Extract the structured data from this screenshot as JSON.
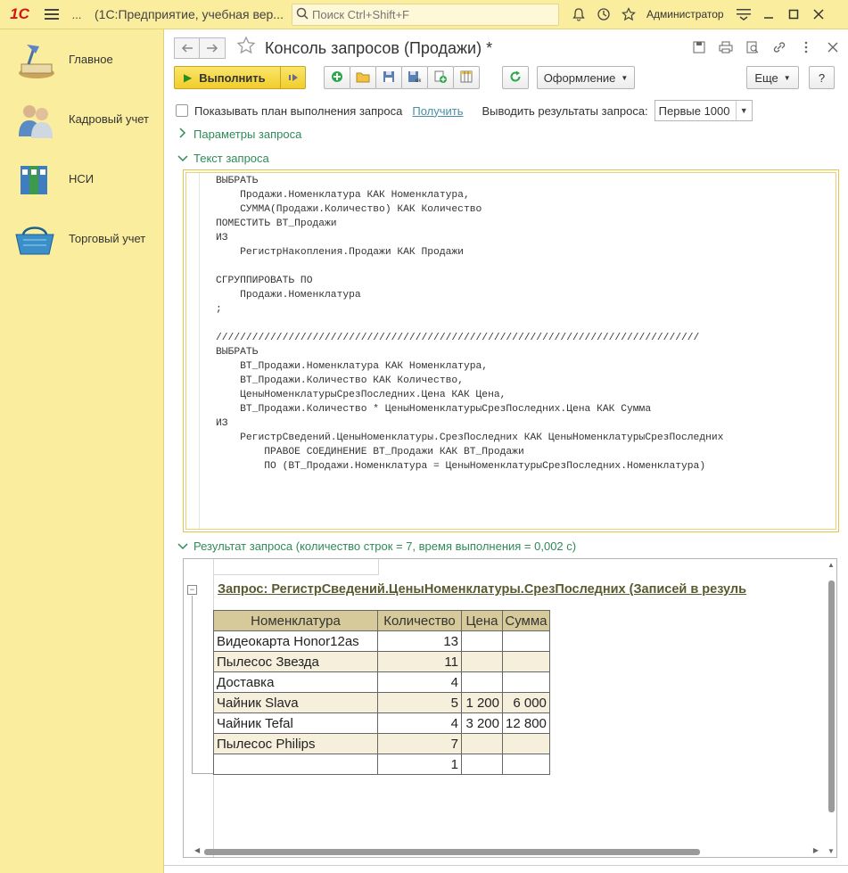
{
  "topbar": {
    "logo": "1С",
    "ellipsis": "...",
    "app_title": "(1С:Предприятие, учебная вер...",
    "search_placeholder": "Поиск Ctrl+Shift+F",
    "user": "Администратор"
  },
  "sidebar": {
    "items": [
      {
        "label": "Главное",
        "icon": "desk-lamp-icon"
      },
      {
        "label": "Кадровый учет",
        "icon": "people-icon"
      },
      {
        "label": "НСИ",
        "icon": "binders-icon"
      },
      {
        "label": "Торговый учет",
        "icon": "basket-icon"
      }
    ]
  },
  "form": {
    "title": "Консоль запросов (Продажи) *"
  },
  "cmdbar": {
    "execute_label": "Выполнить",
    "design_label": "Оформление",
    "more_label": "Еще",
    "help_label": "?"
  },
  "options": {
    "show_plan_label": "Показывать план выполнения запроса",
    "get_link": "Получить",
    "output_label": "Выводить результаты запроса:",
    "output_value": "Первые 1000"
  },
  "groups": {
    "params": "Параметры запроса",
    "text": "Текст запроса",
    "result": "Результат запроса (количество строк = 7, время выполнения = 0,002 с)"
  },
  "query_text": "ВЫБРАТЬ\n    Продажи.Номенклатура КАК Номенклатура,\n    СУММА(Продажи.Количество) КАК Количество\nПОМЕСТИТЬ ВТ_Продажи\nИЗ\n    РегистрНакопления.Продажи КАК Продажи\n\nСГРУППИРОВАТЬ ПО\n    Продажи.Номенклатура\n;\n\n////////////////////////////////////////////////////////////////////////////////\nВЫБРАТЬ\n    ВТ_Продажи.Номенклатура КАК Номенклатура,\n    ВТ_Продажи.Количество КАК Количество,\n    ЦеныНоменклатурыСрезПоследних.Цена КАК Цена,\n    ВТ_Продажи.Количество * ЦеныНоменклатурыСрезПоследних.Цена КАК Сумма\nИЗ\n    РегистрСведений.ЦеныНоменклатуры.СрезПоследних КАК ЦеныНоменклатурыСрезПоследних\n        ПРАВОЕ СОЕДИНЕНИЕ ВТ_Продажи КАК ВТ_Продажи\n        ПО (ВТ_Продажи.Номенклатура = ЦеныНоменклатурыСрезПоследних.Номенклатура)",
  "result": {
    "heading": "Запрос: РегистрСведений.ЦеныНоменклатуры.СрезПоследних (Записей в резуль",
    "columns": [
      "Номенклатура",
      "Количество",
      "Цена",
      "Сумма"
    ],
    "rows": [
      [
        "Видеокарта Honor12as",
        "13",
        "",
        ""
      ],
      [
        "Пылесос Звезда",
        "11",
        "",
        ""
      ],
      [
        "Доставка",
        "4",
        "",
        ""
      ],
      [
        "Чайник Slava",
        "5",
        "1 200",
        "6 000"
      ],
      [
        "Чайник Tefal",
        "4",
        "3 200",
        "12 800"
      ],
      [
        "Пылесос Philips",
        "7",
        "",
        ""
      ],
      [
        "",
        "1",
        "",
        ""
      ]
    ]
  }
}
